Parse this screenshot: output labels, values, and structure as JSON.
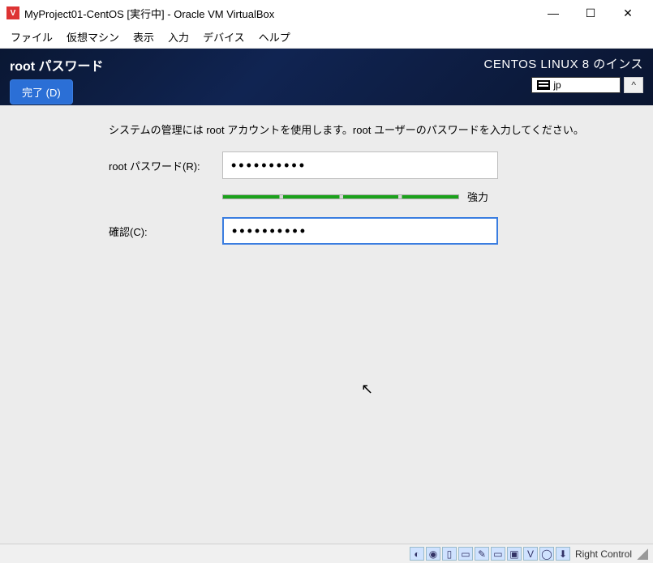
{
  "window": {
    "title": "MyProject01-CentOS [実行中] - Oracle VM VirtualBox",
    "controls": {
      "minimize": "—",
      "maximize": "☐",
      "close": "✕"
    }
  },
  "menubar": {
    "items": [
      "ファイル",
      "仮想マシン",
      "表示",
      "入力",
      "デバイス",
      "ヘルプ"
    ]
  },
  "installer": {
    "screen_title": "root パスワード",
    "done_button": "完了 (D)",
    "distro": "CENTOS LINUX 8 のインス",
    "keyboard_layout": "jp",
    "keyboard_btn": "^"
  },
  "form": {
    "instruction": "システムの管理には root アカウントを使用します。root ユーザーのパスワードを入力してください。",
    "password_label": "root パスワード(R):",
    "password_value": "••••••••••",
    "confirm_label": "確認(C):",
    "confirm_value": "••••••••••",
    "strength_label": "強力"
  },
  "statusbar": {
    "host_key": "Right Control"
  }
}
